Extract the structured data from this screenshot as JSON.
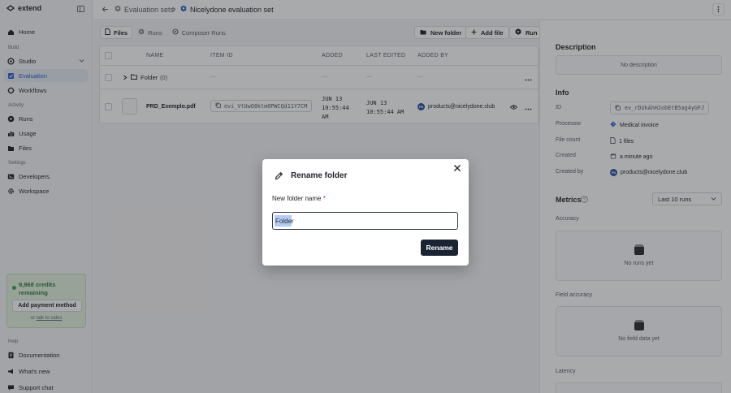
{
  "brand": {
    "name": "extend"
  },
  "sidebar": {
    "top": [
      {
        "label": "Home",
        "icon": "home-icon"
      }
    ],
    "build_label": "Build",
    "build": [
      {
        "label": "Studio",
        "icon": "studio-icon"
      },
      {
        "label": "Evaluation",
        "icon": "evaluation-icon",
        "active": true
      },
      {
        "label": "Workflows",
        "icon": "workflows-icon"
      }
    ],
    "activity_label": "Activity",
    "activity": [
      {
        "label": "Runs",
        "icon": "runs-icon"
      },
      {
        "label": "Usage",
        "icon": "usage-icon"
      },
      {
        "label": "Files",
        "icon": "files-icon"
      }
    ],
    "settings_label": "Settings",
    "settings": [
      {
        "label": "Developers",
        "icon": "developers-icon"
      },
      {
        "label": "Workspace",
        "icon": "workspace-icon"
      }
    ],
    "credits": {
      "amount": "9,968 credits remaining",
      "add_payment": "Add payment method",
      "or": "or",
      "talk_to_sales": "talk to sales"
    },
    "help_label": "Help",
    "help": [
      {
        "label": "Documentation",
        "icon": "documentation-icon"
      },
      {
        "label": "What's new",
        "icon": "megaphone-icon"
      },
      {
        "label": "Support chat",
        "icon": "chat-icon"
      }
    ]
  },
  "header": {
    "breadcrumbs": [
      {
        "label": "Evaluation sets"
      },
      {
        "label": "Nicelydone evaluation set"
      }
    ]
  },
  "toolbar": {
    "tabs": [
      {
        "label": "Files",
        "active": true
      },
      {
        "label": "Runs"
      },
      {
        "label": "Composer Runs"
      }
    ],
    "new_folder": "New folder",
    "add_file": "Add file",
    "run": "Run"
  },
  "table": {
    "columns": [
      "NAME",
      "ITEM ID",
      "ADDED",
      "LAST EDITED",
      "ADDED BY"
    ],
    "folder_row": {
      "name": "Folder",
      "count": "(0)",
      "placeholder": "—"
    },
    "file_row": {
      "name": "PRD_Exemplo.pdf",
      "item_id": "evi_VtUwO8ktm0PWCQd11Y7CM",
      "added": "JUN 13\n10:55:44\nAM",
      "last_edited": "JUN 13\n10:55:44 AM",
      "added_by": "products@nicelydone.club",
      "avatar_initials": "PN"
    }
  },
  "right_panel": {
    "description_title": "Description",
    "description_value": "No description",
    "info_title": "Info",
    "info": {
      "id_label": "ID",
      "id_value": "ev_rDUkAhHJobEtB5ag4yGFJ",
      "processor_label": "Processor",
      "processor_value": "Medical invoice",
      "file_count_label": "File count",
      "file_count_value": "1 files",
      "created_label": "Created",
      "created_value": "a minute ago",
      "created_by_label": "Created by",
      "created_by_value": "products@nicelydone.club"
    },
    "metrics_title": "Metrics",
    "metrics_range": "Last 10 runs",
    "accuracy_label": "Accuracy",
    "accuracy_empty": "No runs yet",
    "field_accuracy_label": "Field accuracy",
    "field_accuracy_empty": "No field data yet",
    "latency_label": "Latency"
  },
  "modal": {
    "title": "Rename folder",
    "field_label": "New folder name",
    "required_mark": "*",
    "input_value": "Folder",
    "submit": "Rename"
  }
}
